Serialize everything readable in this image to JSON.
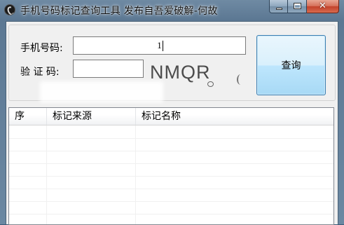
{
  "window": {
    "title": "手机号码标记查询工具  发布自吾爱破解-何故"
  },
  "form": {
    "phone_label": "手机号码:",
    "phone_value": "1",
    "code_label": "验 证 码:",
    "code_value": "",
    "captcha_text": "NMQR",
    "query_button": "查询"
  },
  "results": {
    "columns": [
      "序",
      "标记来源",
      "标记名称"
    ],
    "rows": []
  }
}
